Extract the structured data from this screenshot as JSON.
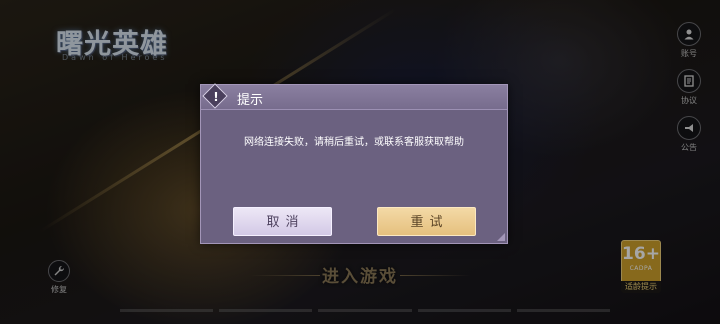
{
  "background": {
    "logo": "曙光英雄",
    "logo_subtitle": "Dawn of Heroes",
    "enter_game": "进入游戏",
    "side_buttons": [
      {
        "icon": "user-icon",
        "label": "账号"
      },
      {
        "icon": "agreement-icon",
        "label": "协议"
      },
      {
        "icon": "megaphone-icon",
        "label": "公告"
      }
    ],
    "repair_label": "修复",
    "age_badge": {
      "age": "16+",
      "org": "CADPA",
      "tip": "适龄提示"
    }
  },
  "dialog": {
    "icon": "exclamation-icon",
    "icon_glyph": "!",
    "title": "提示",
    "message": "网络连接失败，请稍后重试，或联系客服获取帮助",
    "cancel_label": "取消",
    "retry_label": "重试"
  },
  "colors": {
    "dialog_bg": "#6b6180",
    "cancel_bg": "#e3dcef",
    "retry_bg": "#ecce92",
    "age_badge": "#cfa12b"
  }
}
